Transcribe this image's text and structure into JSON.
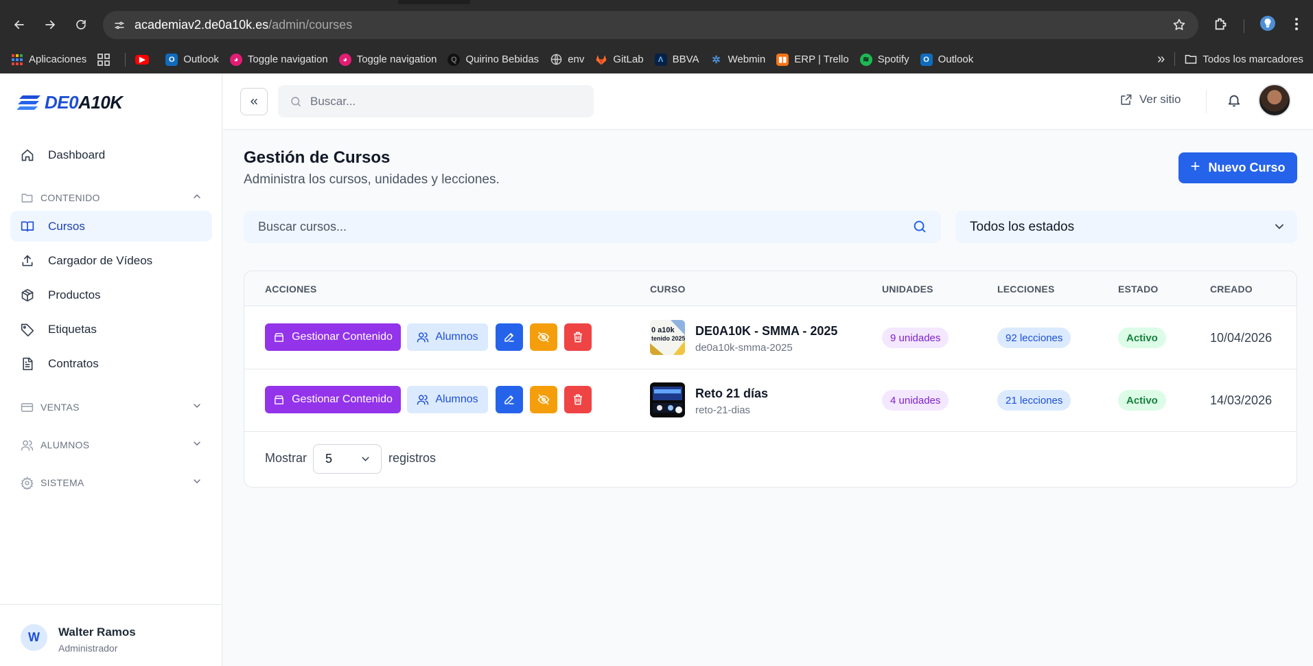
{
  "browser": {
    "url_host": "academiav2.de0a10k.es",
    "url_path": "/admin/courses",
    "bookmarks": [
      {
        "label": "Aplicaciones",
        "icon": "apps-grid-icon",
        "color": "#ea4335"
      },
      {
        "label": "",
        "icon": "grid-icon",
        "color": "#9ca3af"
      },
      {
        "label": "",
        "icon": "youtube-icon",
        "color": "#ff0000"
      },
      {
        "label": "Outlook",
        "icon": "outlook-icon",
        "color": "#0078d4"
      },
      {
        "label": "Toggle navigation",
        "icon": "toggle-nav-icon",
        "color": "#e11d74"
      },
      {
        "label": "Toggle navigation",
        "icon": "toggle-nav-icon",
        "color": "#e11d74"
      },
      {
        "label": "Quirino Bebidas",
        "icon": "quirino-icon",
        "color": "#1f1f1f"
      },
      {
        "label": "env",
        "icon": "globe-icon",
        "color": "#9ca3af"
      },
      {
        "label": "GitLab",
        "icon": "gitlab-icon",
        "color": "#fc6d26"
      },
      {
        "label": "BBVA",
        "icon": "bbva-icon",
        "color": "#1464a5"
      },
      {
        "label": "Webmin",
        "icon": "webmin-icon",
        "color": "#3b82f6"
      },
      {
        "label": "ERP | Trello",
        "icon": "trello-icon",
        "color": "#f97316"
      },
      {
        "label": "Spotify",
        "icon": "spotify-icon",
        "color": "#1db954"
      },
      {
        "label": "Outlook",
        "icon": "outlook-icon",
        "color": "#0078d4"
      }
    ],
    "more_label": "»",
    "all_bookmarks": "Todos los marcadores"
  },
  "sidebar": {
    "logo_left": "DE0",
    "logo_right": "A10K",
    "items": [
      {
        "label": "Dashboard",
        "icon": "home-icon"
      },
      {
        "label": "CONTENIDO",
        "icon": "folder-icon",
        "group": true
      },
      {
        "label": "Cursos",
        "icon": "book-icon",
        "active": true
      },
      {
        "label": "Cargador de Vídeos",
        "icon": "upload-icon"
      },
      {
        "label": "Productos",
        "icon": "box-icon"
      },
      {
        "label": "Etiquetas",
        "icon": "tag-icon"
      },
      {
        "label": "Contratos",
        "icon": "file-text-icon"
      },
      {
        "label": "VENTAS",
        "icon": "card-icon",
        "group": true
      },
      {
        "label": "ALUMNOS",
        "icon": "users-icon",
        "group": true
      },
      {
        "label": "SISTEMA",
        "icon": "gear-icon",
        "group": true
      }
    ],
    "user": {
      "initial": "W",
      "name": "Walter Ramos",
      "role": "Administrador"
    }
  },
  "topbar": {
    "search_placeholder": "Buscar...",
    "ver_sitio": "Ver sitio"
  },
  "main": {
    "title": "Gestión de Cursos",
    "subtitle": "Administra los cursos, unidades y lecciones.",
    "new_button": "Nuevo Curso",
    "search_placeholder": "Buscar cursos...",
    "status_filter": "Todos los estados",
    "columns": [
      "ACCIONES",
      "CURSO",
      "UNIDADES",
      "LECCIONES",
      "ESTADO",
      "CREADO"
    ],
    "actions": {
      "manage": "Gestionar Contenido",
      "students": "Alumnos"
    },
    "rows": [
      {
        "name": "DE0A10K - SMMA - 2025",
        "slug": "de0a10k-smma-2025",
        "units": "9 unidades",
        "lessons": "92 lecciones",
        "status": "Activo",
        "created": "10/04/2026",
        "thumb": "smma"
      },
      {
        "name": "Reto 21 días",
        "slug": "reto-21-dias",
        "units": "4 unidades",
        "lessons": "21 lecciones",
        "status": "Activo",
        "created": "14/03/2026",
        "thumb": "reto"
      }
    ],
    "footer": {
      "show": "Mostrar",
      "per_page": "5",
      "records": "registros"
    }
  }
}
